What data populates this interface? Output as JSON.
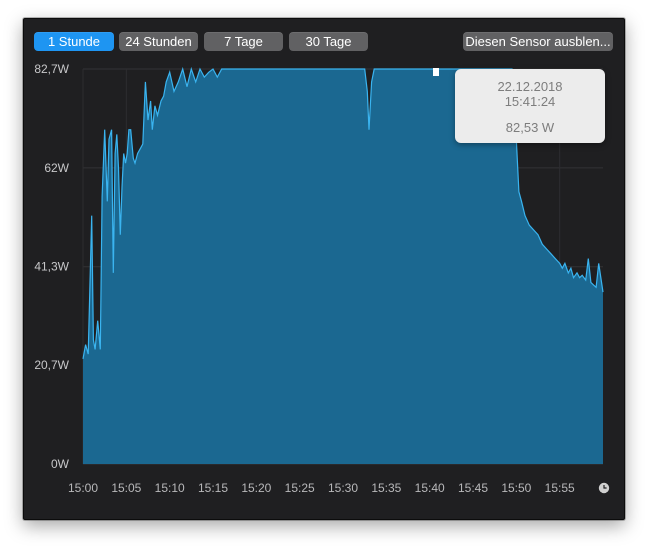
{
  "range_buttons": [
    {
      "label": "1 Stunde",
      "active": true
    },
    {
      "label": "24 Stunden",
      "active": false
    },
    {
      "label": "7 Tage",
      "active": false
    },
    {
      "label": "30 Tage",
      "active": false
    }
  ],
  "hide_sensor_label": "Diesen Sensor ausblen...",
  "tooltip": {
    "date": "22.12.2018",
    "time": "15:41:24",
    "value": "82,53 W"
  },
  "colors": {
    "fill": "#1b6891",
    "line": "#3ab4f0",
    "active": "#1e95f2",
    "background": "#1f1f21"
  },
  "icons": {
    "time_axis": "clock-icon"
  },
  "chart_data": {
    "type": "area",
    "title": "",
    "xlabel": "",
    "ylabel": "",
    "y_tick_labels": [
      "0W",
      "20,7W",
      "41,3W",
      "62W",
      "82,7W"
    ],
    "y_ticks": [
      0,
      20.7,
      41.3,
      62,
      82.7
    ],
    "ylim": [
      0,
      82.7
    ],
    "x_tick_labels": [
      "15:00",
      "15:05",
      "15:10",
      "15:15",
      "15:20",
      "15:25",
      "15:30",
      "15:35",
      "15:40",
      "15:45",
      "15:50",
      "15:55"
    ],
    "xlim_minutes_after_1500": [
      0,
      60
    ],
    "series": [
      {
        "x_minutes_after_1500": [
          0,
          0.3,
          0.6,
          1,
          1.2,
          1.4,
          1.7,
          2,
          2.2,
          2.5,
          2.8,
          3,
          3.3,
          3.5,
          3.7,
          3.9,
          4.1,
          4.3,
          4.5,
          4.7,
          4.9,
          5.1,
          5.3,
          5.5,
          5.8,
          6,
          6.3,
          6.6,
          6.9,
          7.2,
          7.5,
          7.8,
          8,
          8.3,
          8.6,
          9,
          9.3,
          9.6,
          10,
          10.5,
          11,
          11.5,
          12,
          12.5,
          13,
          13.5,
          14,
          14.5,
          15,
          15.5,
          16,
          17,
          18,
          19,
          20,
          21,
          22,
          23,
          24,
          25,
          26,
          27,
          28,
          29,
          30,
          31,
          32,
          32.5,
          32.8,
          33,
          33.3,
          33.6,
          34,
          35,
          36,
          37,
          38,
          39,
          40,
          40.2,
          40.8,
          41,
          41.5,
          42,
          43,
          44,
          45,
          46,
          47,
          48,
          49,
          49.5,
          49.8,
          50,
          50.3,
          50.6,
          51,
          51.5,
          52,
          52.5,
          53,
          53.5,
          54,
          54.5,
          55,
          55.3,
          55.6,
          56,
          56.3,
          56.6,
          57,
          57.3,
          57.6,
          58,
          58.3,
          58.6,
          58.9,
          59.2,
          59.5,
          60
        ],
        "values": [
          22,
          25,
          23,
          52,
          26,
          24,
          30,
          24,
          56,
          70,
          55,
          68,
          70,
          40,
          65,
          69,
          62,
          48,
          58,
          65,
          63,
          65,
          70,
          70,
          64,
          63,
          65,
          66,
          67,
          80,
          72,
          76,
          70,
          75,
          73,
          76,
          77,
          80,
          82,
          78,
          80,
          82.7,
          79,
          82.7,
          80,
          82.7,
          81,
          82,
          82.7,
          81,
          82.7,
          82.7,
          82.7,
          82.7,
          82.7,
          82.7,
          82.7,
          82.7,
          82.7,
          82.7,
          82.7,
          82.7,
          82.7,
          82.7,
          82.7,
          82.7,
          82.7,
          82.7,
          78,
          70,
          80,
          82.7,
          82.7,
          82.7,
          82.7,
          82.7,
          82.7,
          82.7,
          82.7,
          82.7,
          82.7,
          82.7,
          82.7,
          82.7,
          82.7,
          82.7,
          82.7,
          82.7,
          82.7,
          82.7,
          82.7,
          82.7,
          75,
          68,
          57,
          55,
          52,
          50,
          49,
          48,
          46,
          45,
          44,
          43,
          42,
          41,
          42,
          40,
          41,
          39,
          40,
          39,
          39.5,
          38.5,
          43,
          38,
          37.5,
          37,
          42,
          36,
          36
        ]
      }
    ]
  }
}
